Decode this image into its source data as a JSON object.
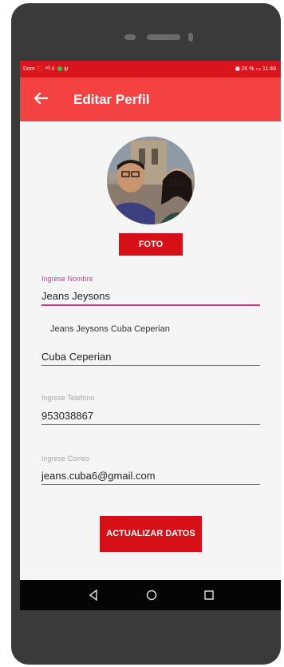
{
  "statusbar": {
    "left_text": "Dom 🚫 ⁴ᴳ.ıl",
    "right_text": "⏰26 % ▭ 11:49",
    "icons": [
      "mute-icon",
      "signal-icon",
      "notification-dot-icon",
      "usb-icon",
      "alarm-icon",
      "battery-icon"
    ]
  },
  "appbar": {
    "back_icon": "arrow-left-icon",
    "title": "Editar Perfil"
  },
  "profile": {
    "photo_button": "FOTO"
  },
  "form": {
    "name_hint": "Ingrese Nombre",
    "name_value": "Jeans Jeysons",
    "full_name": "Jeans Jeysons Cuba Ceperian",
    "surname_value": "Cuba Ceperian",
    "phone_hint": "Ingrese Telefono",
    "phone_value": "953038867",
    "email_hint": "Ingrese Correo",
    "email_value": "jeans.cuba6@gmail.com",
    "update_button": "ACTUALIZAR DATOS"
  },
  "navbar": {
    "icons": [
      "back-triangle-icon",
      "home-circle-icon",
      "recents-square-icon"
    ]
  },
  "colors": {
    "statusbar": "#d9141c",
    "appbar": "#f44242",
    "button": "#d60f17",
    "accent": "#d33a84",
    "navbar": "#050505",
    "device": "#3a3a3a"
  }
}
